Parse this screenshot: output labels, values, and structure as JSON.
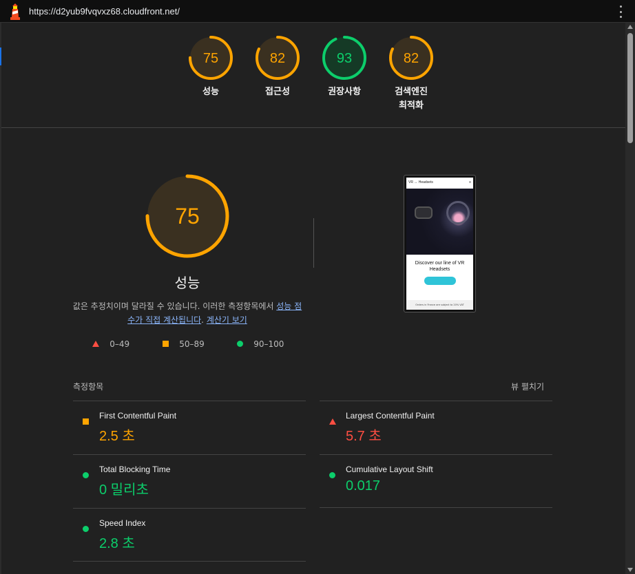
{
  "browser": {
    "url": "https://d2yub9fvqvxz68.cloudfront.net/"
  },
  "colors": {
    "fail": "#ff4e42",
    "average": "#ffa400",
    "pass": "#0cce6b"
  },
  "gauges": [
    {
      "score": 75,
      "label": "성능",
      "rating": "average"
    },
    {
      "score": 82,
      "label": "접근성",
      "rating": "average"
    },
    {
      "score": 93,
      "label": "권장사항",
      "rating": "pass"
    },
    {
      "score": 82,
      "label": "검색엔진 최적화",
      "rating": "average"
    }
  ],
  "performance": {
    "score": 75,
    "title": "성능",
    "description_prefix": "값은 추정치이며 달라질 수 있습니다. 이러한 측정항목에서 ",
    "link1": "성능 점수가 직접 계산됩니다",
    "description_mid": ". ",
    "link2": "계산기 보기",
    "legend": {
      "fail": "0–49",
      "average": "50–89",
      "pass": "90–100"
    }
  },
  "preview": {
    "nav_brand": "VR ↔ Headsets",
    "nav_menu": "≡",
    "headline": "Discover our line of VR Headsets",
    "footer": "Orders in France are subject to 20% VAT"
  },
  "metrics": {
    "header": "측정항목",
    "expand": "뷰 펼치기",
    "items": [
      {
        "name": "First Contentful Paint",
        "value": "2.5 초",
        "rating": "average"
      },
      {
        "name": "Largest Contentful Paint",
        "value": "5.7 초",
        "rating": "fail"
      },
      {
        "name": "Total Blocking Time",
        "value": "0 밀리초",
        "rating": "pass"
      },
      {
        "name": "Cumulative Layout Shift",
        "value": "0.017",
        "rating": "pass"
      },
      {
        "name": "Speed Index",
        "value": "2.8 초",
        "rating": "pass"
      }
    ]
  }
}
